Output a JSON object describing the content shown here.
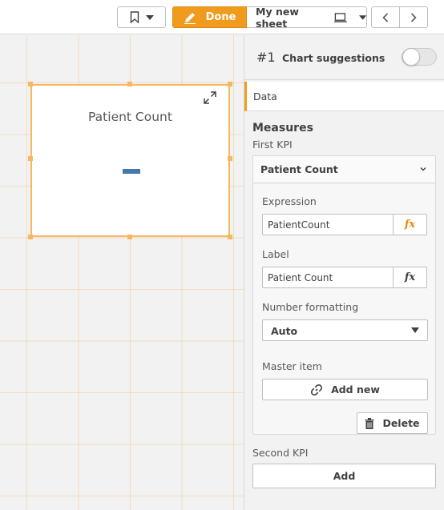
{
  "toolbar": {
    "done_label": "Done",
    "sheet_title": "My new sheet",
    "icons": {
      "bookmark": "bookmark-icon",
      "bookmark_dropdown": "caret-down-icon",
      "edit": "pencil-icon",
      "sheet": "sheet-monitor-icon",
      "sheet_dropdown": "caret-down-icon",
      "previous": "chevron-left-icon",
      "next": "chevron-right-icon"
    }
  },
  "canvas": {
    "kpi_object": {
      "title": "Patient Count",
      "value": "–",
      "expand_icon": "expand-icon"
    }
  },
  "panel": {
    "object_number": "#1",
    "chart_suggestions_label": "Chart suggestions",
    "chart_suggestions_on": false,
    "data_tab": "Data",
    "measures_heading": "Measures",
    "first_kpi_label": "First KPI",
    "measure": {
      "header": "Patient Count",
      "expression_label": "Expression",
      "expression_value": "PatientCount",
      "label_label": "Label",
      "label_value": "Patient Count",
      "fx": "fx",
      "number_formatting_label": "Number formatting",
      "number_formatting_value": "Auto",
      "master_item_label": "Master item",
      "add_new_label": "Add new",
      "delete_label": "Delete"
    },
    "second_kpi_label": "Second KPI",
    "add_label": "Add"
  },
  "colors": {
    "accent": "#f09b1e",
    "selection_border": "#f5b860",
    "kpi_value": "#4477aa",
    "fx_active": "#e08a10"
  }
}
